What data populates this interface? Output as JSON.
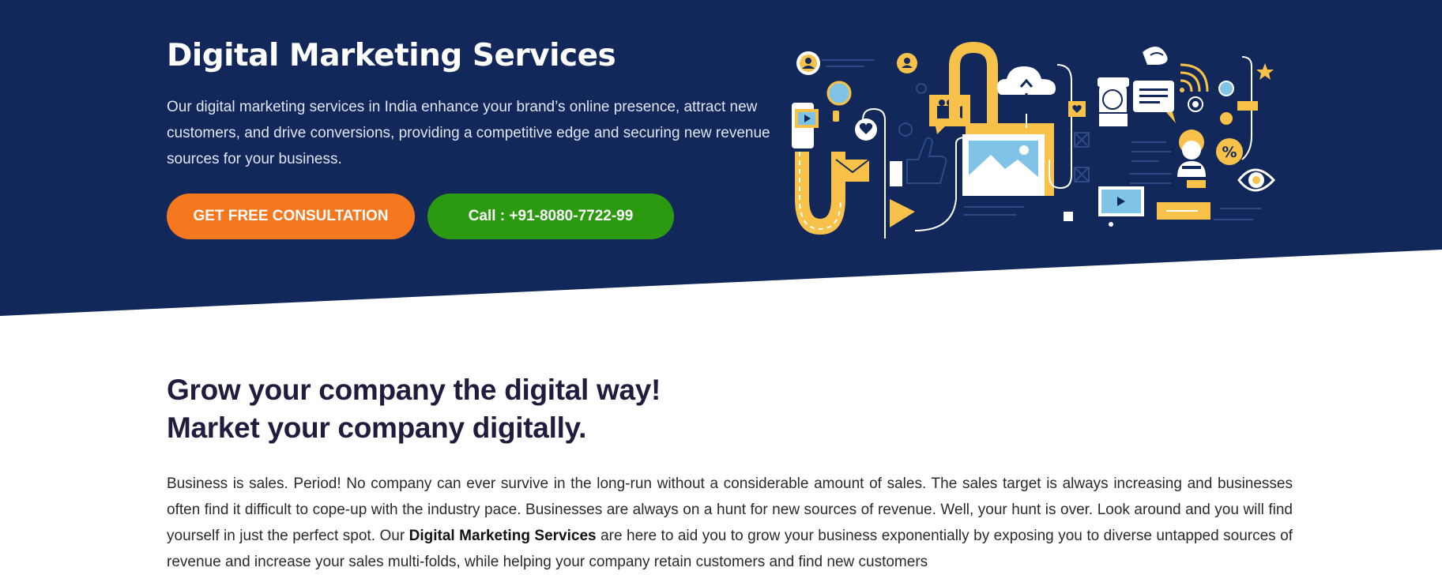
{
  "hero": {
    "title": "Digital Marketing Services",
    "description": "Our digital marketing services in India enhance your brand’s online presence, attract new customers, and drive conversions, providing a competitive edge and securing new revenue sources for your business.",
    "cta_primary": "GET FREE CONSULTATION",
    "cta_secondary": "Call : +91-8080-7722-99",
    "colors": {
      "background": "#12285a",
      "primary_button": "#f5781f",
      "secondary_button": "#2c9a10",
      "accent": "#f7c14a"
    },
    "illustration": {
      "icons": [
        "user-avatar-icon",
        "play-icon",
        "heart-icon",
        "mail-icon",
        "video-camera-icon",
        "cloud-upload-icon",
        "image-icon",
        "support-agent-icon",
        "chat-bubble-icon",
        "wifi-icon",
        "percent-icon",
        "eye-icon",
        "star-icon",
        "thumbs-up-icon",
        "magnet-icon"
      ]
    }
  },
  "intro": {
    "title_line1": "Grow your company the digital way!",
    "title_line2": "Market your company digitally.",
    "body_before": "Business is sales. Period! No company can ever survive in the long-run without a considerable amount of sales. The sales target is always increasing and businesses often find it difficult to cope-up with the industry pace. Businesses are always on a hunt for new sources of revenue. Well, your hunt is over. Look around and you will find yourself in just the perfect spot. Our ",
    "body_bold": "Digital Marketing Services",
    "body_after": " are here to aid you to grow your business exponentially by exposing you to diverse untapped sources of revenue and increase your sales multi-folds, while helping your company retain customers and find new customers"
  }
}
